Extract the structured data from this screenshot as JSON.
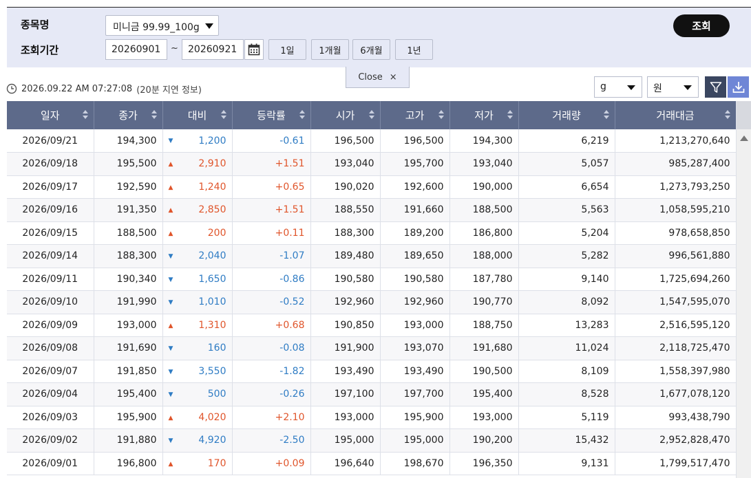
{
  "search": {
    "name_label": "종목명",
    "period_label": "조회기간",
    "product": "미니금 99.99_100g",
    "date_from": "20260901",
    "date_sep": "~",
    "date_to": "20260921",
    "period_buttons": [
      "1일",
      "1개월",
      "6개월",
      "1년"
    ],
    "search_button": "조회"
  },
  "close_tab": {
    "label": "Close",
    "icon": "×"
  },
  "timestamp": {
    "time": "2026.09.22 AM 07:27:08",
    "note": "(20분 지연 정보)"
  },
  "units": {
    "weight": "g",
    "currency": "원"
  },
  "table": {
    "headers": [
      "일자",
      "종가",
      "대비",
      "등락률",
      "시가",
      "고가",
      "저가",
      "거래량",
      "거래대금"
    ],
    "rows": [
      {
        "date": "2026/09/21",
        "close": "194,300",
        "dir": "down",
        "diff": "1,200",
        "rate": "-0.61",
        "open": "196,500",
        "high": "196,500",
        "low": "194,300",
        "volume": "6,219",
        "amount": "1,213,270,640"
      },
      {
        "date": "2026/09/18",
        "close": "195,500",
        "dir": "up",
        "diff": "2,910",
        "rate": "+1.51",
        "open": "193,040",
        "high": "195,700",
        "low": "193,040",
        "volume": "5,057",
        "amount": "985,287,400"
      },
      {
        "date": "2026/09/17",
        "close": "192,590",
        "dir": "up",
        "diff": "1,240",
        "rate": "+0.65",
        "open": "190,020",
        "high": "192,600",
        "low": "190,000",
        "volume": "6,654",
        "amount": "1,273,793,250"
      },
      {
        "date": "2026/09/16",
        "close": "191,350",
        "dir": "up",
        "diff": "2,850",
        "rate": "+1.51",
        "open": "188,550",
        "high": "191,660",
        "low": "188,500",
        "volume": "5,563",
        "amount": "1,058,595,210"
      },
      {
        "date": "2026/09/15",
        "close": "188,500",
        "dir": "up",
        "diff": "200",
        "rate": "+0.11",
        "open": "188,300",
        "high": "189,200",
        "low": "186,800",
        "volume": "5,204",
        "amount": "978,658,850"
      },
      {
        "date": "2026/09/14",
        "close": "188,300",
        "dir": "down",
        "diff": "2,040",
        "rate": "-1.07",
        "open": "189,480",
        "high": "189,650",
        "low": "188,000",
        "volume": "5,282",
        "amount": "996,561,880"
      },
      {
        "date": "2026/09/11",
        "close": "190,340",
        "dir": "down",
        "diff": "1,650",
        "rate": "-0.86",
        "open": "190,580",
        "high": "190,580",
        "low": "187,780",
        "volume": "9,140",
        "amount": "1,725,694,260"
      },
      {
        "date": "2026/09/10",
        "close": "191,990",
        "dir": "down",
        "diff": "1,010",
        "rate": "-0.52",
        "open": "192,960",
        "high": "192,960",
        "low": "190,770",
        "volume": "8,092",
        "amount": "1,547,595,070"
      },
      {
        "date": "2026/09/09",
        "close": "193,000",
        "dir": "up",
        "diff": "1,310",
        "rate": "+0.68",
        "open": "190,850",
        "high": "193,000",
        "low": "188,750",
        "volume": "13,283",
        "amount": "2,516,595,120"
      },
      {
        "date": "2026/09/08",
        "close": "191,690",
        "dir": "down",
        "diff": "160",
        "rate": "-0.08",
        "open": "191,900",
        "high": "193,070",
        "low": "191,680",
        "volume": "11,024",
        "amount": "2,118,725,470"
      },
      {
        "date": "2026/09/07",
        "close": "191,850",
        "dir": "down",
        "diff": "3,550",
        "rate": "-1.82",
        "open": "193,490",
        "high": "193,490",
        "low": "190,500",
        "volume": "8,109",
        "amount": "1,558,397,980"
      },
      {
        "date": "2026/09/04",
        "close": "195,400",
        "dir": "down",
        "diff": "500",
        "rate": "-0.26",
        "open": "197,100",
        "high": "197,700",
        "low": "195,400",
        "volume": "8,528",
        "amount": "1,677,078,120"
      },
      {
        "date": "2026/09/03",
        "close": "195,900",
        "dir": "up",
        "diff": "4,020",
        "rate": "+2.10",
        "open": "193,000",
        "high": "195,900",
        "low": "193,000",
        "volume": "5,119",
        "amount": "993,438,790"
      },
      {
        "date": "2026/09/02",
        "close": "191,880",
        "dir": "down",
        "diff": "4,920",
        "rate": "-2.50",
        "open": "195,000",
        "high": "195,000",
        "low": "190,200",
        "volume": "15,432",
        "amount": "2,952,828,470"
      },
      {
        "date": "2026/09/01",
        "close": "196,800",
        "dir": "up",
        "diff": "170",
        "rate": "+0.09",
        "open": "196,640",
        "high": "198,670",
        "low": "196,350",
        "volume": "9,131",
        "amount": "1,799,517,470"
      }
    ]
  },
  "colors": {
    "up": "#e0552b",
    "down": "#2f7cc4",
    "header": "#5d6a8a",
    "panel": "#e6e9f6"
  },
  "icons": {
    "calendar": "calendar-icon",
    "clock": "clock-icon",
    "filter": "filter-icon",
    "download": "download-icon"
  }
}
